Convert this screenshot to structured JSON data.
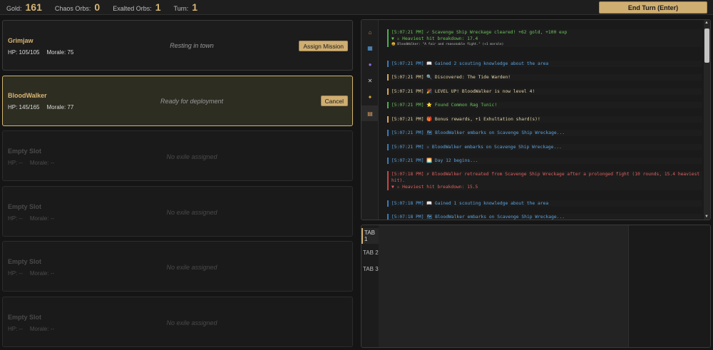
{
  "header": {
    "gold_label": "Gold:",
    "gold_value": "161",
    "chaos_label": "Chaos Orbs:",
    "chaos_value": "0",
    "exalted_label": "Exalted Orbs:",
    "exalted_value": "1",
    "turn_label": "Turn:",
    "turn_value": "1",
    "end_turn_label": "End Turn (Enter)"
  },
  "slots": [
    {
      "name": "Grimjaw",
      "hp": "HP: 105/105",
      "morale": "Morale: 75",
      "status": "Resting in town",
      "button": "Assign Mission"
    },
    {
      "name": "BloodWalker",
      "hp": "HP: 145/165",
      "morale": "Morale: 77",
      "status": "Ready for deployment",
      "button": "Cancel"
    },
    {
      "name": "Empty Slot",
      "hp": "HP: --",
      "morale": "Morale: --",
      "status": "No exile assigned"
    },
    {
      "name": "Empty Slot",
      "hp": "HP: --",
      "morale": "Morale: --",
      "status": "No exile assigned"
    },
    {
      "name": "Empty Slot",
      "hp": "HP: --",
      "morale": "Morale: --",
      "status": "No exile assigned"
    },
    {
      "name": "Empty Slot",
      "hp": "HP: --",
      "morale": "Morale: --",
      "status": "No exile assigned"
    }
  ],
  "log_icons": [
    "home-icon",
    "map-icon",
    "person-icon",
    "swords-icon",
    "sparkle-icon",
    "scroll-icon"
  ],
  "log": [
    {
      "text": "[5:07:21 PM] ✓ Scavenge Ship Wreckage cleared! +62 gold, +100 exp",
      "sub": "▼ ⚔ Heaviest hit breakdown: 17.4",
      "small": "😃 BloodWalker: \"A fair and reasonable fight.\" (+1 morale)"
    },
    {
      "text": "[5:07:21 PM] 📖 Gained 2 scouting knowledge about the area"
    },
    {
      "text": "[5:07:21 PM] 🔍 Discovered: The Tide Warden!"
    },
    {
      "text": "[5:07:21 PM] 🎉 LEVEL UP! BloodWalker is now level 4!"
    },
    {
      "text": "[5:07:21 PM] ⭐ Found Common Rag Tunic!"
    },
    {
      "text": "[5:07:21 PM] 🎁 Bonus rewards, +1 Exhultation shard(s)!"
    },
    {
      "text": "[5:07:21 PM] 🗺 BloodWalker embarks on Scavenge Ship Wreckage..."
    },
    {
      "text": "[5:07:21 PM] ⚔ BloodWalker embarks on Scavenge Ship Wreckage..."
    },
    {
      "text": "[5:07:21 PM] 🌅 Day 12 begins..."
    },
    {
      "text": "[5:07:18 PM] ✗ BloodWalker retreated from Scavenge Ship Wreckage after a prolonged fight (10 rounds, 15.4 heaviest hit).",
      "sub": "▼ ⚔ Heaviest hit breakdown: 15.5"
    },
    {
      "text": "[5:07:18 PM] 📖 Gained 1 scouting knowledge about the area"
    },
    {
      "text": "[5:07:18 PM] 🗺 BloodWalker embarks on Scavenge Ship Wreckage..."
    }
  ],
  "tabs": [
    "TAB 1",
    "TAB 2",
    "TAB 3"
  ]
}
